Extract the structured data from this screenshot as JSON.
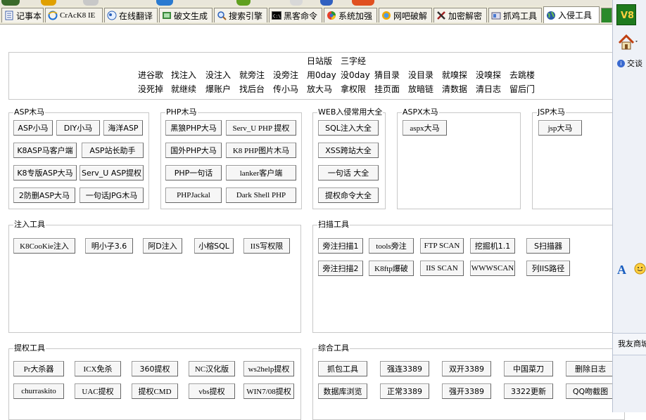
{
  "tabs": [
    {
      "label": "记事本",
      "icon": "notepad-icon"
    },
    {
      "label": "CrAcK8 IE",
      "icon": "ie-icon"
    },
    {
      "label": "在线翻译",
      "icon": "translate-icon"
    },
    {
      "label": "破文生成",
      "icon": "crack-icon"
    },
    {
      "label": "搜索引擎",
      "icon": "search-icon"
    },
    {
      "label": "黑客命令",
      "icon": "cmd-icon"
    },
    {
      "label": "系统加强",
      "icon": "system-icon"
    },
    {
      "label": "网吧破解",
      "icon": "netcafe-icon"
    },
    {
      "label": "加密解密",
      "icon": "encrypt-icon"
    },
    {
      "label": "抓鸡工具",
      "icon": "tool-icon"
    },
    {
      "label": "入侵工具",
      "icon": "globe-icon"
    }
  ],
  "links": {
    "row1": [
      "日站版",
      "三字经"
    ],
    "row2": [
      "进谷歌",
      "找注入",
      "没注入",
      "就旁注",
      "没旁注",
      "用0day",
      "没0day",
      "猜目录",
      "没目录",
      "就嗅探",
      "没嗅探",
      "去跳楼"
    ],
    "row3": [
      "没死掉",
      "就继续",
      "爆账户",
      "找后台",
      "传小马",
      "放大马",
      "拿权限",
      "挂页面",
      "放暗链",
      "清数据",
      "清日志",
      "留后门"
    ]
  },
  "groups": {
    "asp": {
      "title": "ASP木马",
      "buttons": [
        "ASP小马",
        "DIY小马",
        "海洋ASP",
        "K8ASP马客户端",
        "ASP站长助手",
        "K8专版ASP大马",
        "Serv_U ASP提权",
        "2防删ASP大马",
        "一句话JPG木马"
      ]
    },
    "php": {
      "title": "PHP木马",
      "buttons": [
        "黑狼PHP大马",
        "Serv_U PHP 提权",
        "国外PHP大马",
        "K8 PHP图片木马",
        "PHP一句话",
        "lanker客户端",
        "PHPJackal",
        "Dark Shell PHP"
      ]
    },
    "web": {
      "title": "WEB入侵常用大全",
      "buttons": [
        "SQL注入大全",
        "XSS跨站大全",
        "一句话 大全",
        "提权命令大全"
      ]
    },
    "aspx": {
      "title": "ASPX木马",
      "buttons": [
        "aspx大马"
      ]
    },
    "jsp": {
      "title": "JSP木马",
      "buttons": [
        "jsp大马"
      ]
    },
    "inject": {
      "title": "注入工具",
      "buttons": [
        "K8CooKie注入",
        "明小子3.6",
        "阿D注入",
        "小榕SQL",
        "IIS写权限"
      ]
    },
    "scan": {
      "title": "扫描工具",
      "buttons": [
        "旁注扫描1",
        "tools旁注",
        "FTP SCAN",
        "挖掘机1.1",
        "S扫描器",
        "旁注扫描2",
        "K8ftp爆破",
        "IIS SCAN",
        "WWWSCAN",
        "列IIS路径"
      ]
    },
    "priv": {
      "title": "提权工具",
      "buttons": [
        "Pr大杀器",
        "ICX免杀",
        "360提权",
        "NC汉化版",
        "ws2help提权",
        "churraskito",
        "UAC提权",
        "提权CMD",
        "vbs提权",
        "WIN7/08提权"
      ]
    },
    "misc": {
      "title": "综合工具",
      "buttons": [
        "抓包工具",
        "强连3389",
        "双开3389",
        "中国菜刀",
        "删除日志",
        "数据库浏览",
        "正常3389",
        "强开3389",
        "3322更新",
        "QQ吻截图"
      ]
    }
  },
  "right_panel": {
    "item": "交谈",
    "bottom": "我友商城"
  },
  "colors": {
    "tabbar": "#ece9d8",
    "group_border": "#c8c8c8",
    "button_bg": "#f6f6f6"
  }
}
